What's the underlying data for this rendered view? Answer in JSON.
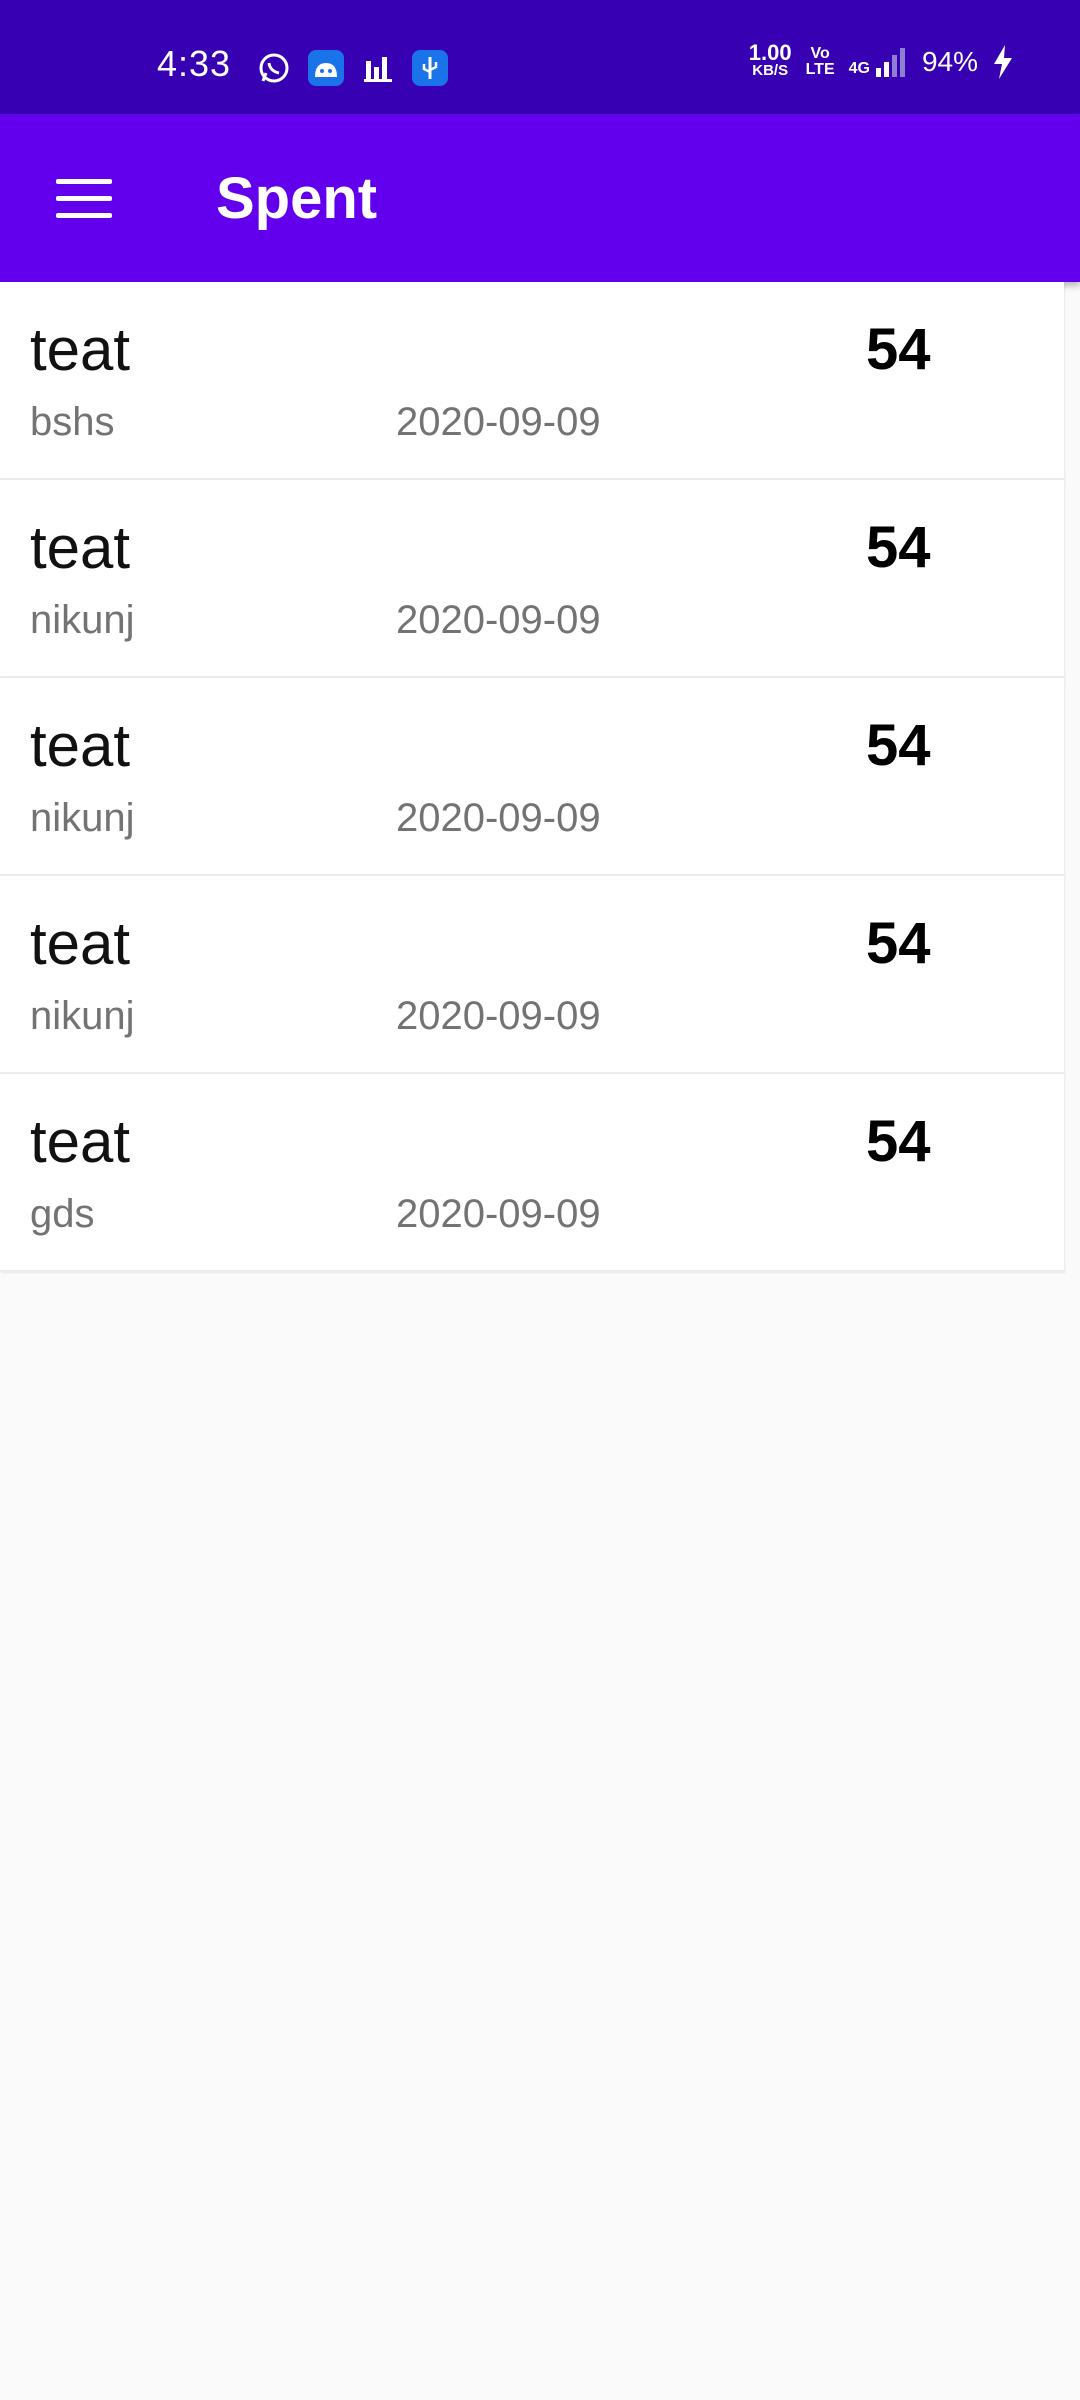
{
  "status_bar": {
    "time": "4:33",
    "speed_value": "1.00",
    "speed_unit": "KB/S",
    "volte_top": "Vo",
    "volte_bottom": "LTE",
    "network": "4G",
    "battery": "94%",
    "icons": [
      "whatsapp-icon",
      "android-icon",
      "bar-chart-icon",
      "usb-icon",
      "signal-icon",
      "charging-icon"
    ]
  },
  "app_bar": {
    "title": "Spent",
    "color": "#6200ee",
    "status_color": "#3700b3"
  },
  "items": [
    {
      "title": "teat",
      "subtitle": "bshs",
      "date": "2020-09-09",
      "amount": "54"
    },
    {
      "title": "teat",
      "subtitle": "nikunj",
      "date": "2020-09-09",
      "amount": "54"
    },
    {
      "title": "teat",
      "subtitle": "nikunj",
      "date": "2020-09-09",
      "amount": "54"
    },
    {
      "title": "teat",
      "subtitle": "nikunj",
      "date": "2020-09-09",
      "amount": "54"
    },
    {
      "title": "teat",
      "subtitle": "gds",
      "date": "2020-09-09",
      "amount": "54"
    }
  ]
}
